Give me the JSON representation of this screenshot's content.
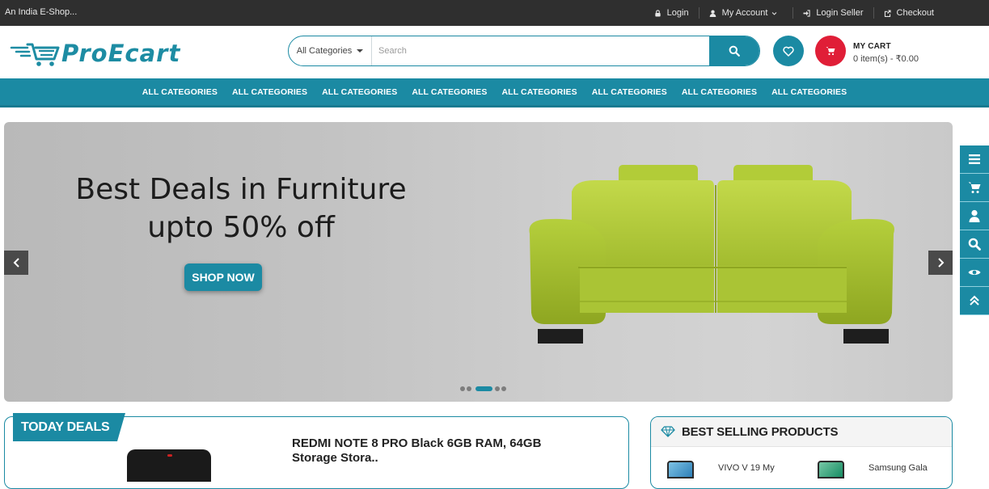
{
  "topbar": {
    "tagline": "An India E-Shop...",
    "links": [
      {
        "label": "Login",
        "icon": "lock-icon"
      },
      {
        "label": "My Account",
        "icon": "user-icon"
      },
      {
        "label": "Login Seller",
        "icon": "sign-in-icon"
      },
      {
        "label": "Checkout",
        "icon": "share-icon"
      }
    ]
  },
  "header": {
    "logo_text": "ProEcart",
    "search": {
      "category": "All Categories",
      "placeholder": "Search"
    },
    "cart": {
      "title": "MY CART",
      "summary": "0 item(s) - ₹0.00"
    }
  },
  "nav": {
    "items": [
      "ALL CATEGORIES",
      "ALL CATEGORIES",
      "ALL CATEGORIES",
      "ALL CATEGORIES",
      "ALL CATEGORIES",
      "ALL CATEGORIES",
      "ALL CATEGORIES",
      "ALL CATEGORIES"
    ]
  },
  "hero": {
    "headline_line1": "Best Deals in Furniture",
    "headline_line2": "upto 50% off",
    "cta": "SHOP NOW",
    "slides": 5,
    "active_slide": 3
  },
  "side_tools": [
    "list-icon",
    "cart-icon",
    "user-icon",
    "search-icon",
    "eye-icon",
    "chevron-up-icon"
  ],
  "deals": {
    "badge": "TODAY DEALS",
    "product_title": "REDMI NOTE 8 PRO Black 6GB RAM, 64GB Storage Stora.."
  },
  "best_selling": {
    "title": "BEST SELLING PRODUCTS",
    "items": [
      {
        "name": "VIVO V 19 My"
      },
      {
        "name": "Samsung Gala"
      }
    ]
  },
  "colors": {
    "accent": "#1b8aa3",
    "cart": "#e01e37",
    "topbar": "#2f2f2f"
  }
}
